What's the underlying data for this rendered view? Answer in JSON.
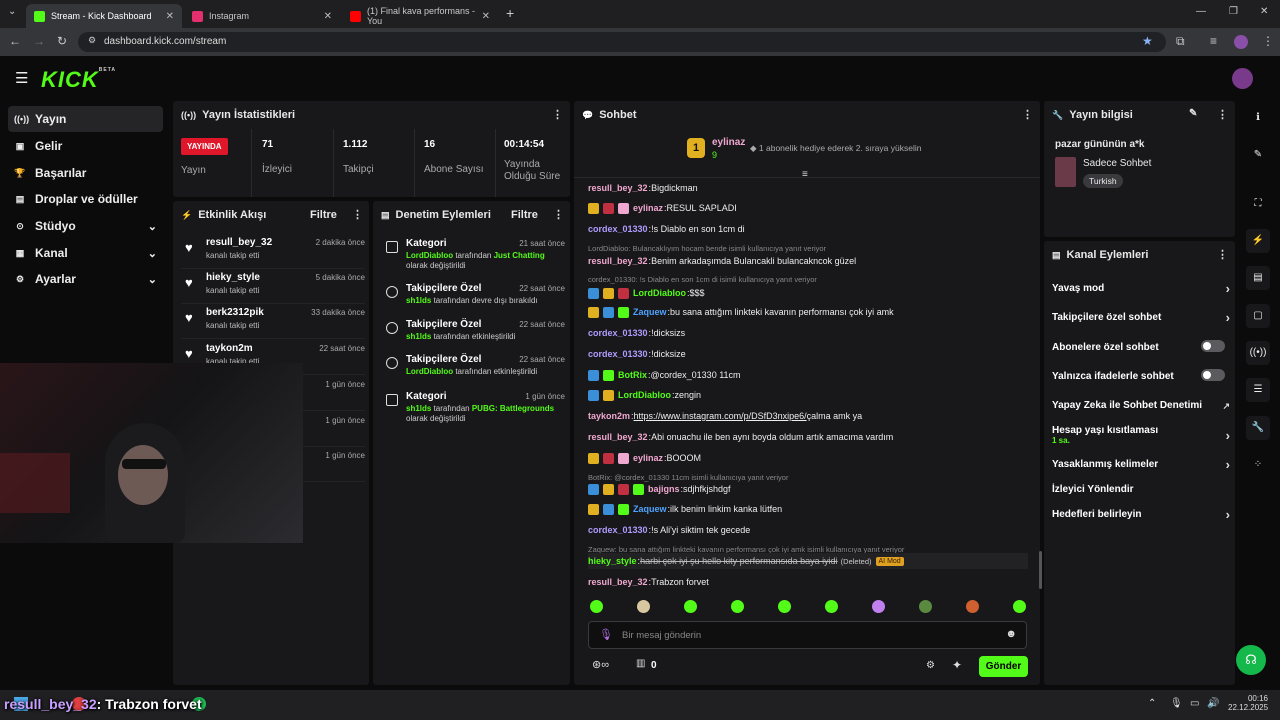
{
  "browser": {
    "tabs": [
      {
        "label": "Stream - Kick Dashboard",
        "color": "#53fc18",
        "active": true
      },
      {
        "label": "Instagram",
        "color": "#e1306c",
        "active": false
      },
      {
        "label": "(1) Final kava performans - You",
        "color": "#ff0000",
        "active": false
      }
    ],
    "url": "dashboard.kick.com/stream"
  },
  "kick": {
    "logo": "KICK",
    "beta": "BETA"
  },
  "sidebar": {
    "items": [
      {
        "label": "Yayın",
        "icon": "broadcast-icon",
        "selected": true
      },
      {
        "label": "Gelir",
        "icon": "revenue-icon"
      },
      {
        "label": "Başarılar",
        "icon": "trophy-icon"
      },
      {
        "label": "Droplar ve ödüller",
        "icon": "gift-icon"
      },
      {
        "label": "Stüdyo",
        "icon": "studio-icon",
        "chevron": true
      },
      {
        "label": "Kanal",
        "icon": "channel-icon",
        "chevron": true
      },
      {
        "label": "Ayarlar",
        "icon": "gear-icon",
        "chevron": true
      }
    ]
  },
  "stats": {
    "title": "Yayın İstatistikleri",
    "live_badge": "YAYINDA",
    "live_label": "Yayın",
    "items": [
      {
        "value": "71",
        "label": "İzleyici"
      },
      {
        "value": "1.112",
        "label": "Takipçi"
      },
      {
        "value": "16",
        "label": "Abone Sayısı"
      },
      {
        "value": "00:14:54",
        "label": "Yayında Olduğu Süre"
      }
    ]
  },
  "activity": {
    "title": "Etkinlik Akışı",
    "filter": "Filtre",
    "rows": [
      {
        "name": "resull_bey_32",
        "sub": "kanalı takip etti",
        "time": "2 dakika önce"
      },
      {
        "name": "hieky_style",
        "sub": "kanalı takip etti",
        "time": "5 dakika önce"
      },
      {
        "name": "berk2312pik",
        "sub": "kanalı takip etti",
        "time": "33 dakika önce"
      },
      {
        "name": "taykon2m",
        "sub": "kanalı takip etti",
        "time": "22 saat önce"
      },
      {
        "time": "1 gün önce"
      },
      {
        "time": "1 gün önce"
      },
      {
        "time": "1 gün önce"
      }
    ]
  },
  "moderation": {
    "title": "Denetim Eylemleri",
    "filter": "Filtre",
    "rows": [
      {
        "title": "Kategori",
        "time": "21 saat önce",
        "user": "LordDiabloo",
        "mid": " tarafından ",
        "hl": "Just Chatting",
        "tail": "olarak değiştirildi"
      },
      {
        "title": "Takipçilere Özel",
        "time": "22 saat önce",
        "user": "sh1lds",
        "mid": " tarafından devre dışı bırakıldı",
        "hl": "",
        "tail": ""
      },
      {
        "title": "Takipçilere Özel",
        "time": "22 saat önce",
        "user": "sh1lds",
        "mid": " tarafından etkinleştirildi",
        "hl": "",
        "tail": ""
      },
      {
        "title": "Takipçilere Özel",
        "time": "22 saat önce",
        "user": "LordDiabloo",
        "mid": " tarafından etkinleştirildi",
        "hl": "",
        "tail": ""
      },
      {
        "title": "Kategori",
        "time": "1 gün önce",
        "user": "sh1lds",
        "mid": " tarafından ",
        "hl": "PUBG: Battlegrounds",
        "tail": "olarak değiştirildi"
      }
    ]
  },
  "chat": {
    "title": "Sohbet",
    "pinned_user": "eylinaz",
    "pinned_rank": "1",
    "pinned_count": "9",
    "pinned_note": "1 abonelik hediye ederek 2. sıraya yükselin",
    "input_placeholder": "Bir mesaj gönderin",
    "points": "0",
    "send": "Gönder",
    "messages": [
      {
        "user": "resull_bey_32",
        "color": "#f0a8d0",
        "text": "Bigdickman"
      },
      {
        "user": "eylinaz",
        "color": "#f0a8d0",
        "text": "RESUL SAPLADI",
        "badges": [
          "#e0b020",
          "#c03040",
          "#f0a8d0"
        ]
      },
      {
        "user": "cordex_01330",
        "color": "#b09cff",
        "text": "!s Diablo en son 1cm di"
      },
      {
        "reply": "LordDiabloo: Bulancaklıyım hocam bende isimli kullanıcıya yanıt veriyor"
      },
      {
        "user": "resull_bey_32",
        "color": "#f0a8d0",
        "text": "Benim arkadaşımda Bulancakli bulancakncok güzel"
      },
      {
        "reply": "cordex_01330: !s Diablo en son 1cm di isimli kullanıcıya yanıt veriyor"
      },
      {
        "user": "LordDiabloo",
        "color": "#53fc18",
        "text": "$$$",
        "badges": [
          "#3a8fd8",
          "#e0b020",
          "#c03040"
        ]
      },
      {
        "user": "Zaquew",
        "color": "#4fa3ff",
        "text": "bu sana attığım linkteki kavanın performansı çok iyi amk",
        "badges": [
          "#e0b020",
          "#3a8fd8",
          "#53fc18"
        ]
      },
      {
        "user": "cordex_01330",
        "color": "#b09cff",
        "text": "!dicksizs"
      },
      {
        "user": "cordex_01330",
        "color": "#b09cff",
        "text": "!dicksize"
      },
      {
        "user": "BotRix",
        "color": "#53fc18",
        "text": "@cordex_01330 11cm",
        "badges": [
          "#3a8fd8",
          "#53fc18"
        ]
      },
      {
        "user": "LordDiabloo",
        "color": "#53fc18",
        "text": "zengin",
        "badges": [
          "#3a8fd8",
          "#e0b020"
        ]
      },
      {
        "user": "taykon2m",
        "color": "#f0a8d0",
        "text": "https://www.instagram.com/p/DSfD3nxipe6/",
        "tail": " çalma amk ya"
      },
      {
        "user": "resull_bey_32",
        "color": "#f0a8d0",
        "text": "Abi onuachu ile ben aynı boyda oldum artık amacıma vardım"
      },
      {
        "user": "eylinaz",
        "color": "#f0a8d0",
        "text": "BOOOM",
        "badges": [
          "#e0b020",
          "#c03040",
          "#f0a8d0"
        ]
      },
      {
        "reply": "BotRix: @cordex_01330 11cm isimli kullanıcıya yanıt veriyor"
      },
      {
        "user": "bajigns",
        "color": "#f0a8d0",
        "text": "sdjhfkjshdgf",
        "badges": [
          "#3a8fd8",
          "#e0b020",
          "#c03040",
          "#53fc18"
        ]
      },
      {
        "user": "Zaquew",
        "color": "#4fa3ff",
        "text": "ilk benim linkim kanka lütfen",
        "badges": [
          "#e0b020",
          "#3a8fd8",
          "#53fc18"
        ]
      },
      {
        "user": "cordex_01330",
        "color": "#b09cff",
        "text": "!s Ali'yi siktim tek gecede"
      },
      {
        "reply": "Zaquew: bu sana attığım linkteki kavanın performansı çok iyi amk isimli kullanıcıya yanıt veriyor"
      },
      {
        "user": "hieky_style",
        "color": "#53fc18",
        "text": "harbi çok iyi şu hello kity performansıda baya iyidi",
        "deleted": "(Deleted)",
        "ai": "AI Mod"
      },
      {
        "user": "resull_bey_32",
        "color": "#f0a8d0",
        "text": "Trabzon forvet"
      }
    ],
    "emotes": [
      "#53fc18",
      "#d8c8a0",
      "#53fc18",
      "#53fc18",
      "#53fc18",
      "#53fc18",
      "#c080f0",
      "#5a8a40",
      "#d06030",
      "#53fc18"
    ]
  },
  "streaminfo": {
    "title": "Yayın bilgisi",
    "stream_title": "pazar gününün a*k",
    "category": "Sadece Sohbet",
    "tag": "Turkish"
  },
  "actions": {
    "title": "Kanal Eylemleri",
    "rows": [
      {
        "label": "Yavaş mod",
        "type": "chevron"
      },
      {
        "label": "Takipçilere özel sohbet",
        "type": "chevron"
      },
      {
        "label": "Abonelere özel sohbet",
        "type": "toggle"
      },
      {
        "label": "Yalnızca ifadelerle sohbet",
        "type": "toggle"
      },
      {
        "label": "Yapay Zeka ile Sohbet Denetimi",
        "type": "external"
      },
      {
        "label": "Hesap yaşı kısıtlaması",
        "sub": "1 sa.",
        "type": "chevron"
      },
      {
        "label": "Yasaklanmış kelimeler",
        "type": "chevron"
      },
      {
        "label": "İzleyici Yönlendir",
        "type": "none"
      },
      {
        "label": "Hedefleri belirleyin",
        "type": "chevron"
      }
    ]
  },
  "overlay": {
    "user": "resull_bey_32",
    "text": ": Trabzon forvet"
  },
  "taskbar": {
    "time": "00:16",
    "date": "22.12.2025"
  }
}
